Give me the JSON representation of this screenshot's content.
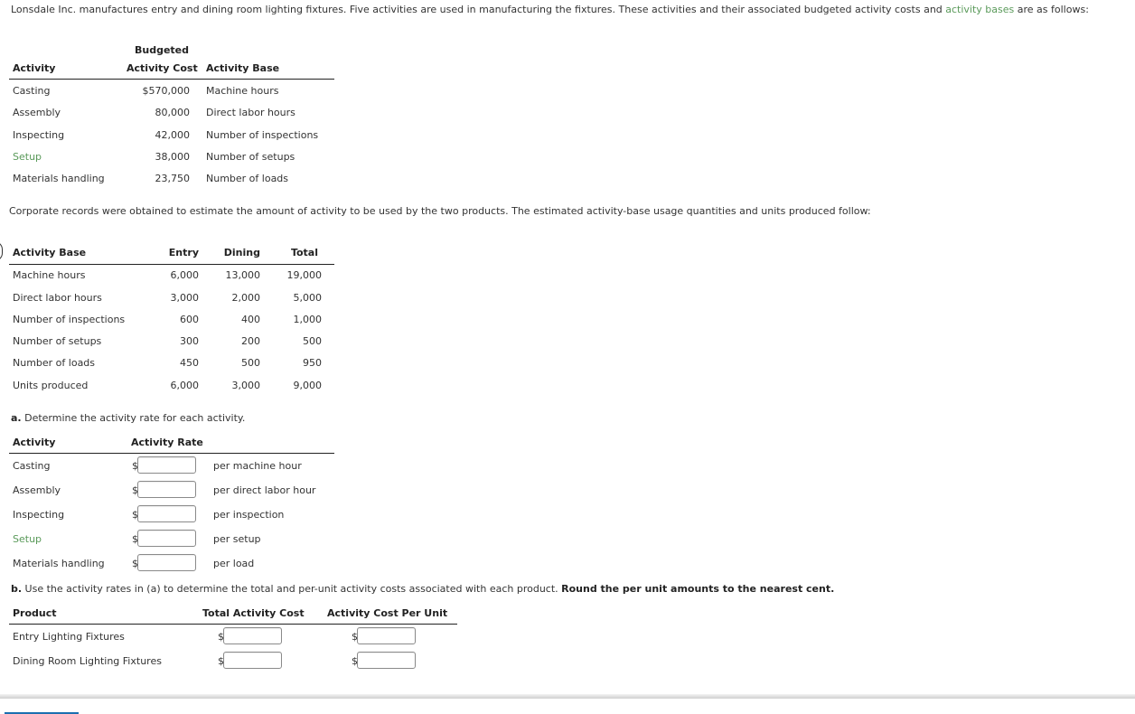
{
  "intro": {
    "text_before": "Lonsdale Inc. manufactures entry and dining room lighting fixtures. Five activities are used in manufacturing the fixtures. These activities and their associated budgeted activity costs and ",
    "link": "activity bases",
    "text_after": " are as follows:"
  },
  "table1": {
    "headers": {
      "activity": "Activity",
      "cost_line1": "Budgeted",
      "cost_line2": "Activity Cost",
      "base": "Activity Base"
    },
    "rows": [
      {
        "activity": "Casting",
        "cost": "$570,000",
        "base": "Machine hours"
      },
      {
        "activity": "Assembly",
        "cost": "80,000",
        "base": "Direct labor hours"
      },
      {
        "activity": "Inspecting",
        "cost": "42,000",
        "base": "Number of inspections"
      },
      {
        "activity": "Setup",
        "cost": "38,000",
        "base": "Number of setups"
      },
      {
        "activity": "Materials handling",
        "cost": "23,750",
        "base": "Number of loads"
      }
    ]
  },
  "corporate_text": "Corporate records were obtained to estimate the amount of activity to be used by the two products. The estimated activity-base usage quantities and units produced follow:",
  "table2": {
    "headers": {
      "base": "Activity Base",
      "entry": "Entry",
      "dining": "Dining",
      "total": "Total"
    },
    "rows": [
      {
        "base": "Machine hours",
        "entry": "6,000",
        "dining": "13,000",
        "total": "19,000"
      },
      {
        "base": "Direct labor hours",
        "entry": "3,000",
        "dining": "2,000",
        "total": "5,000"
      },
      {
        "base": "Number of inspections",
        "entry": "600",
        "dining": "400",
        "total": "1,000"
      },
      {
        "base": "Number of setups",
        "entry": "300",
        "dining": "200",
        "total": "500"
      },
      {
        "base": "Number of loads",
        "entry": "450",
        "dining": "500",
        "total": "950"
      },
      {
        "base": "Units produced",
        "entry": "6,000",
        "dining": "3,000",
        "total": "9,000"
      }
    ]
  },
  "part_a": {
    "label": "a.",
    "text": " Determine the activity rate for each activity.",
    "headers": {
      "activity": "Activity",
      "rate": "Activity Rate"
    },
    "currency": "$",
    "rows": [
      {
        "activity": "Casting",
        "value": "",
        "unit": "per machine hour"
      },
      {
        "activity": "Assembly",
        "value": "",
        "unit": "per direct labor hour"
      },
      {
        "activity": "Inspecting",
        "value": "",
        "unit": "per inspection"
      },
      {
        "activity": "Setup",
        "value": "",
        "unit": "per setup"
      },
      {
        "activity": "Materials handling",
        "value": "",
        "unit": "per load"
      }
    ]
  },
  "part_b": {
    "label": "b.",
    "text": " Use the activity rates in (a) to determine the total and per-unit activity costs associated with each product. ",
    "bold_text": "Round the per unit amounts to the nearest cent.",
    "headers": {
      "product": "Product",
      "total": "Total Activity Cost",
      "per_unit": "Activity Cost Per Unit"
    },
    "currency": "$",
    "rows": [
      {
        "product": "Entry Lighting Fixtures",
        "total": "",
        "per_unit": ""
      },
      {
        "product": "Dining Room Lighting Fixtures",
        "total": "",
        "per_unit": ""
      }
    ]
  },
  "colors": {
    "link_green": "#5a9a5a",
    "tab_blue": "#1c6fb0"
  }
}
